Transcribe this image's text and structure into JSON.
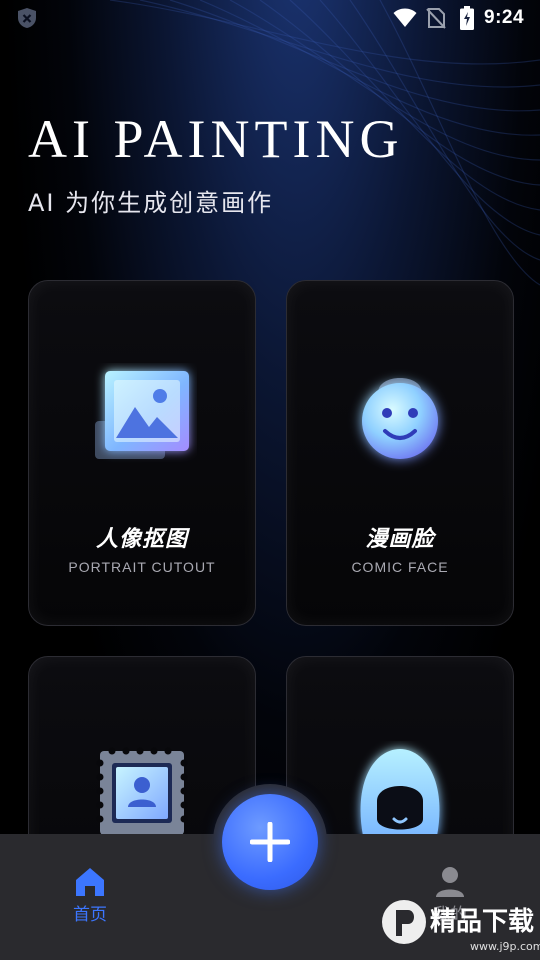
{
  "status_bar": {
    "time": "9:24",
    "icons": [
      "shield-icon",
      "wifi-icon",
      "no-sim-icon",
      "battery-icon"
    ]
  },
  "header": {
    "title": "AI PAINTING",
    "subtitle": "AI 为你生成创意画作"
  },
  "cards": [
    {
      "title": "人像抠图",
      "subtitle": "PORTRAIT CUTOUT",
      "icon": "image-icon"
    },
    {
      "title": "漫画脸",
      "subtitle": "COMIC FACE",
      "icon": "smiley-face-icon"
    },
    {
      "title": "",
      "subtitle": "",
      "icon": "stamp-portrait-icon"
    },
    {
      "title": "",
      "subtitle": "",
      "icon": "hair-avatar-icon"
    }
  ],
  "bottom_nav": {
    "home_label": "首页",
    "me_label": "我的",
    "fab_icon": "plus-icon"
  },
  "watermark": {
    "brand": "精品下载",
    "site": "www.j9p.com"
  },
  "colors": {
    "accent": "#3c76ff",
    "card_bg": "#08080b",
    "nav_bg": "#2a2a2e",
    "icon_glow": "#8fd0ff"
  }
}
